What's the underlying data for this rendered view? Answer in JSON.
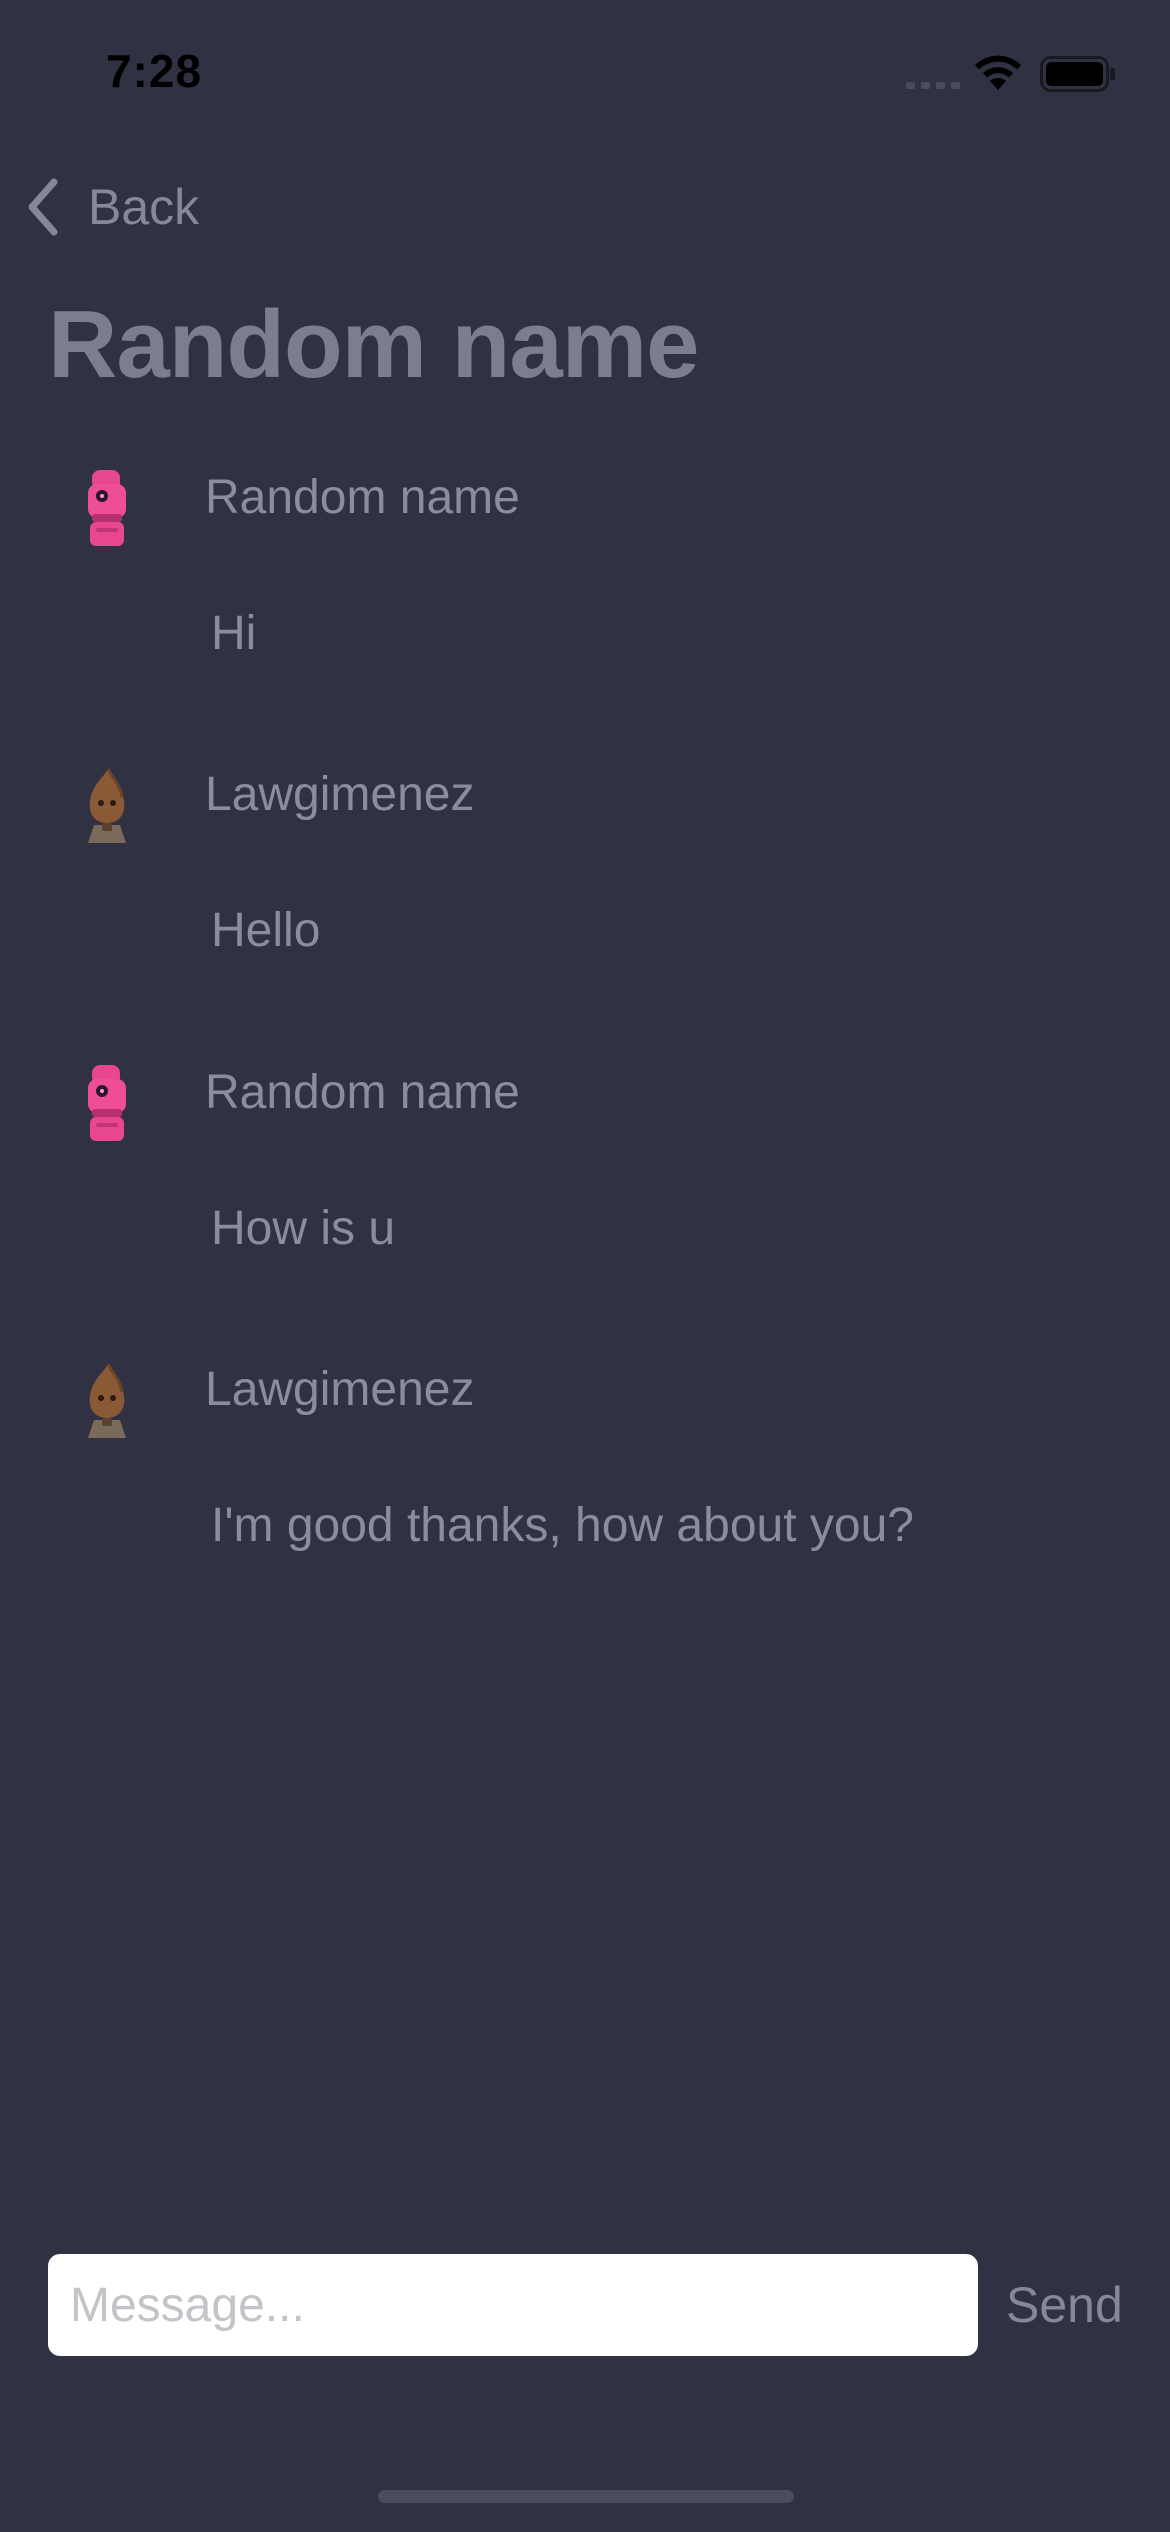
{
  "status_bar": {
    "time": "7:28",
    "icons": [
      "signal-icon",
      "wifi-icon",
      "battery-icon"
    ]
  },
  "nav": {
    "back_label": "Back",
    "back_icon": "chevron-left-icon"
  },
  "header": {
    "title": "Random name"
  },
  "messages": [
    {
      "author": "Random name",
      "text": "Hi",
      "avatar": "pink-robot-avatar"
    },
    {
      "author": "Lawgimenez",
      "text": "Hello",
      "avatar": "brown-creature-avatar"
    },
    {
      "author": "Random name",
      "text": "How is u",
      "avatar": "pink-robot-avatar"
    },
    {
      "author": "Lawgimenez",
      "text": "I'm good thanks, how about you?",
      "avatar": "brown-creature-avatar"
    }
  ],
  "composer": {
    "placeholder": "Message...",
    "value": "",
    "send_label": "Send"
  },
  "colors": {
    "background": "#303243",
    "title": "#7c7e8f",
    "text": "#8b8d9c",
    "input_background": "#ffffff",
    "avatar_pink": "#e8468f",
    "avatar_brown": "#8a5a36"
  }
}
